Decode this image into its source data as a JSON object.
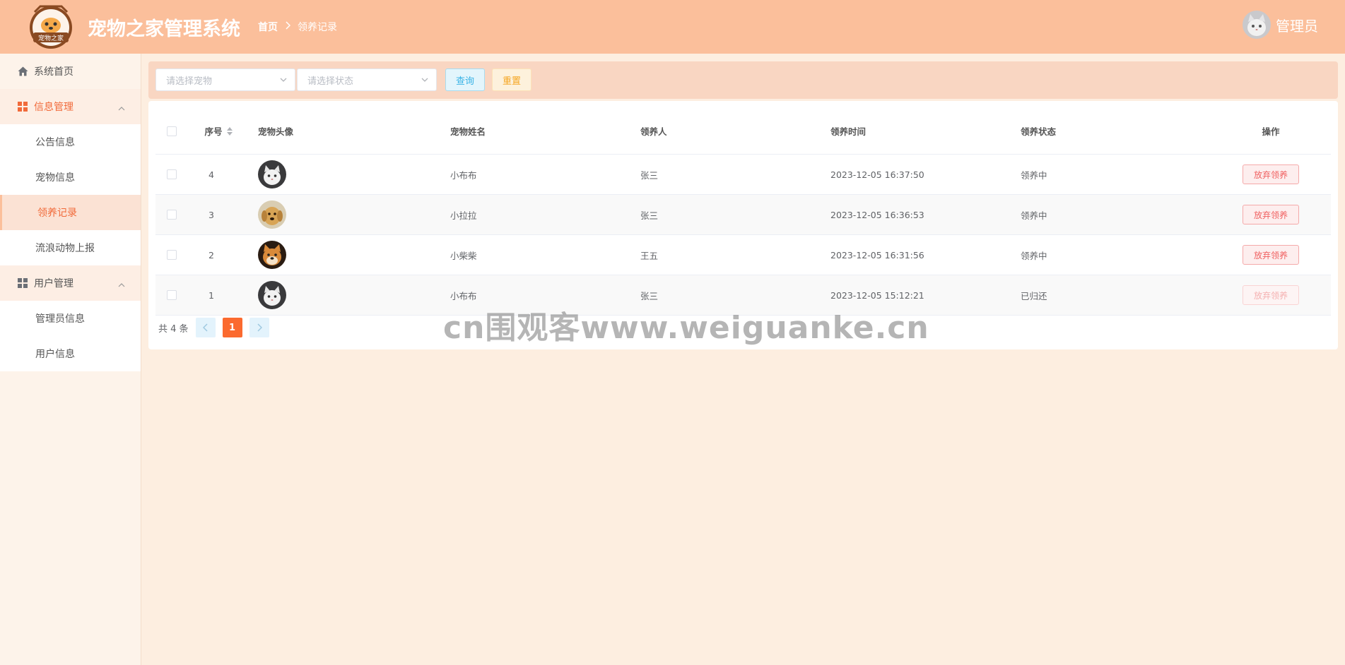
{
  "header": {
    "title": "宠物之家管理系统",
    "logo_text": "宠物之家",
    "breadcrumb": {
      "home": "首页",
      "current": "领养记录"
    },
    "user_name": "管理员"
  },
  "sidebar": {
    "home": {
      "label": "系统首页",
      "icon": "home-icon"
    },
    "groups": [
      {
        "label": "信息管理",
        "icon": "grid-icon",
        "expanded": true,
        "items": [
          {
            "label": "公告信息"
          },
          {
            "label": "宠物信息"
          },
          {
            "label": "领养记录",
            "active": true
          },
          {
            "label": "流浪动物上报"
          }
        ]
      },
      {
        "label": "用户管理",
        "icon": "grid-icon",
        "expanded": true,
        "items": [
          {
            "label": "管理员信息"
          },
          {
            "label": "用户信息"
          }
        ]
      }
    ]
  },
  "search": {
    "pet_placeholder": "请选择宠物",
    "status_placeholder": "请选择状态",
    "query_label": "查询",
    "reset_label": "重置"
  },
  "table": {
    "headers": {
      "index": "序号",
      "avatar": "宠物头像",
      "name": "宠物姓名",
      "adopter": "领养人",
      "time": "领养时间",
      "status": "领养状态",
      "actions": "操作"
    },
    "rows": [
      {
        "index": "4",
        "pet": "cat",
        "name": "小布布",
        "adopter": "张三",
        "time": "2023-12-05 16:37:50",
        "status": "领养中",
        "action": "放弃领养",
        "disabled": false
      },
      {
        "index": "3",
        "pet": "golden",
        "name": "小拉拉",
        "adopter": "张三",
        "time": "2023-12-05 16:36:53",
        "status": "领养中",
        "action": "放弃领养",
        "disabled": false
      },
      {
        "index": "2",
        "pet": "shiba",
        "name": "小柴柴",
        "adopter": "王五",
        "time": "2023-12-05 16:31:56",
        "status": "领养中",
        "action": "放弃领养",
        "disabled": false
      },
      {
        "index": "1",
        "pet": "cat",
        "name": "小布布",
        "adopter": "张三",
        "time": "2023-12-05 15:12:21",
        "status": "已归还",
        "action": "放弃领养",
        "disabled": true
      }
    ]
  },
  "pagination": {
    "total_text": "共 4 条",
    "current_page": "1"
  },
  "watermark": "cn围观客www.weiguanke.cn",
  "colors": {
    "header": "#fbbf9b",
    "accent": "#f16a3a",
    "page": "#fdeee0"
  }
}
